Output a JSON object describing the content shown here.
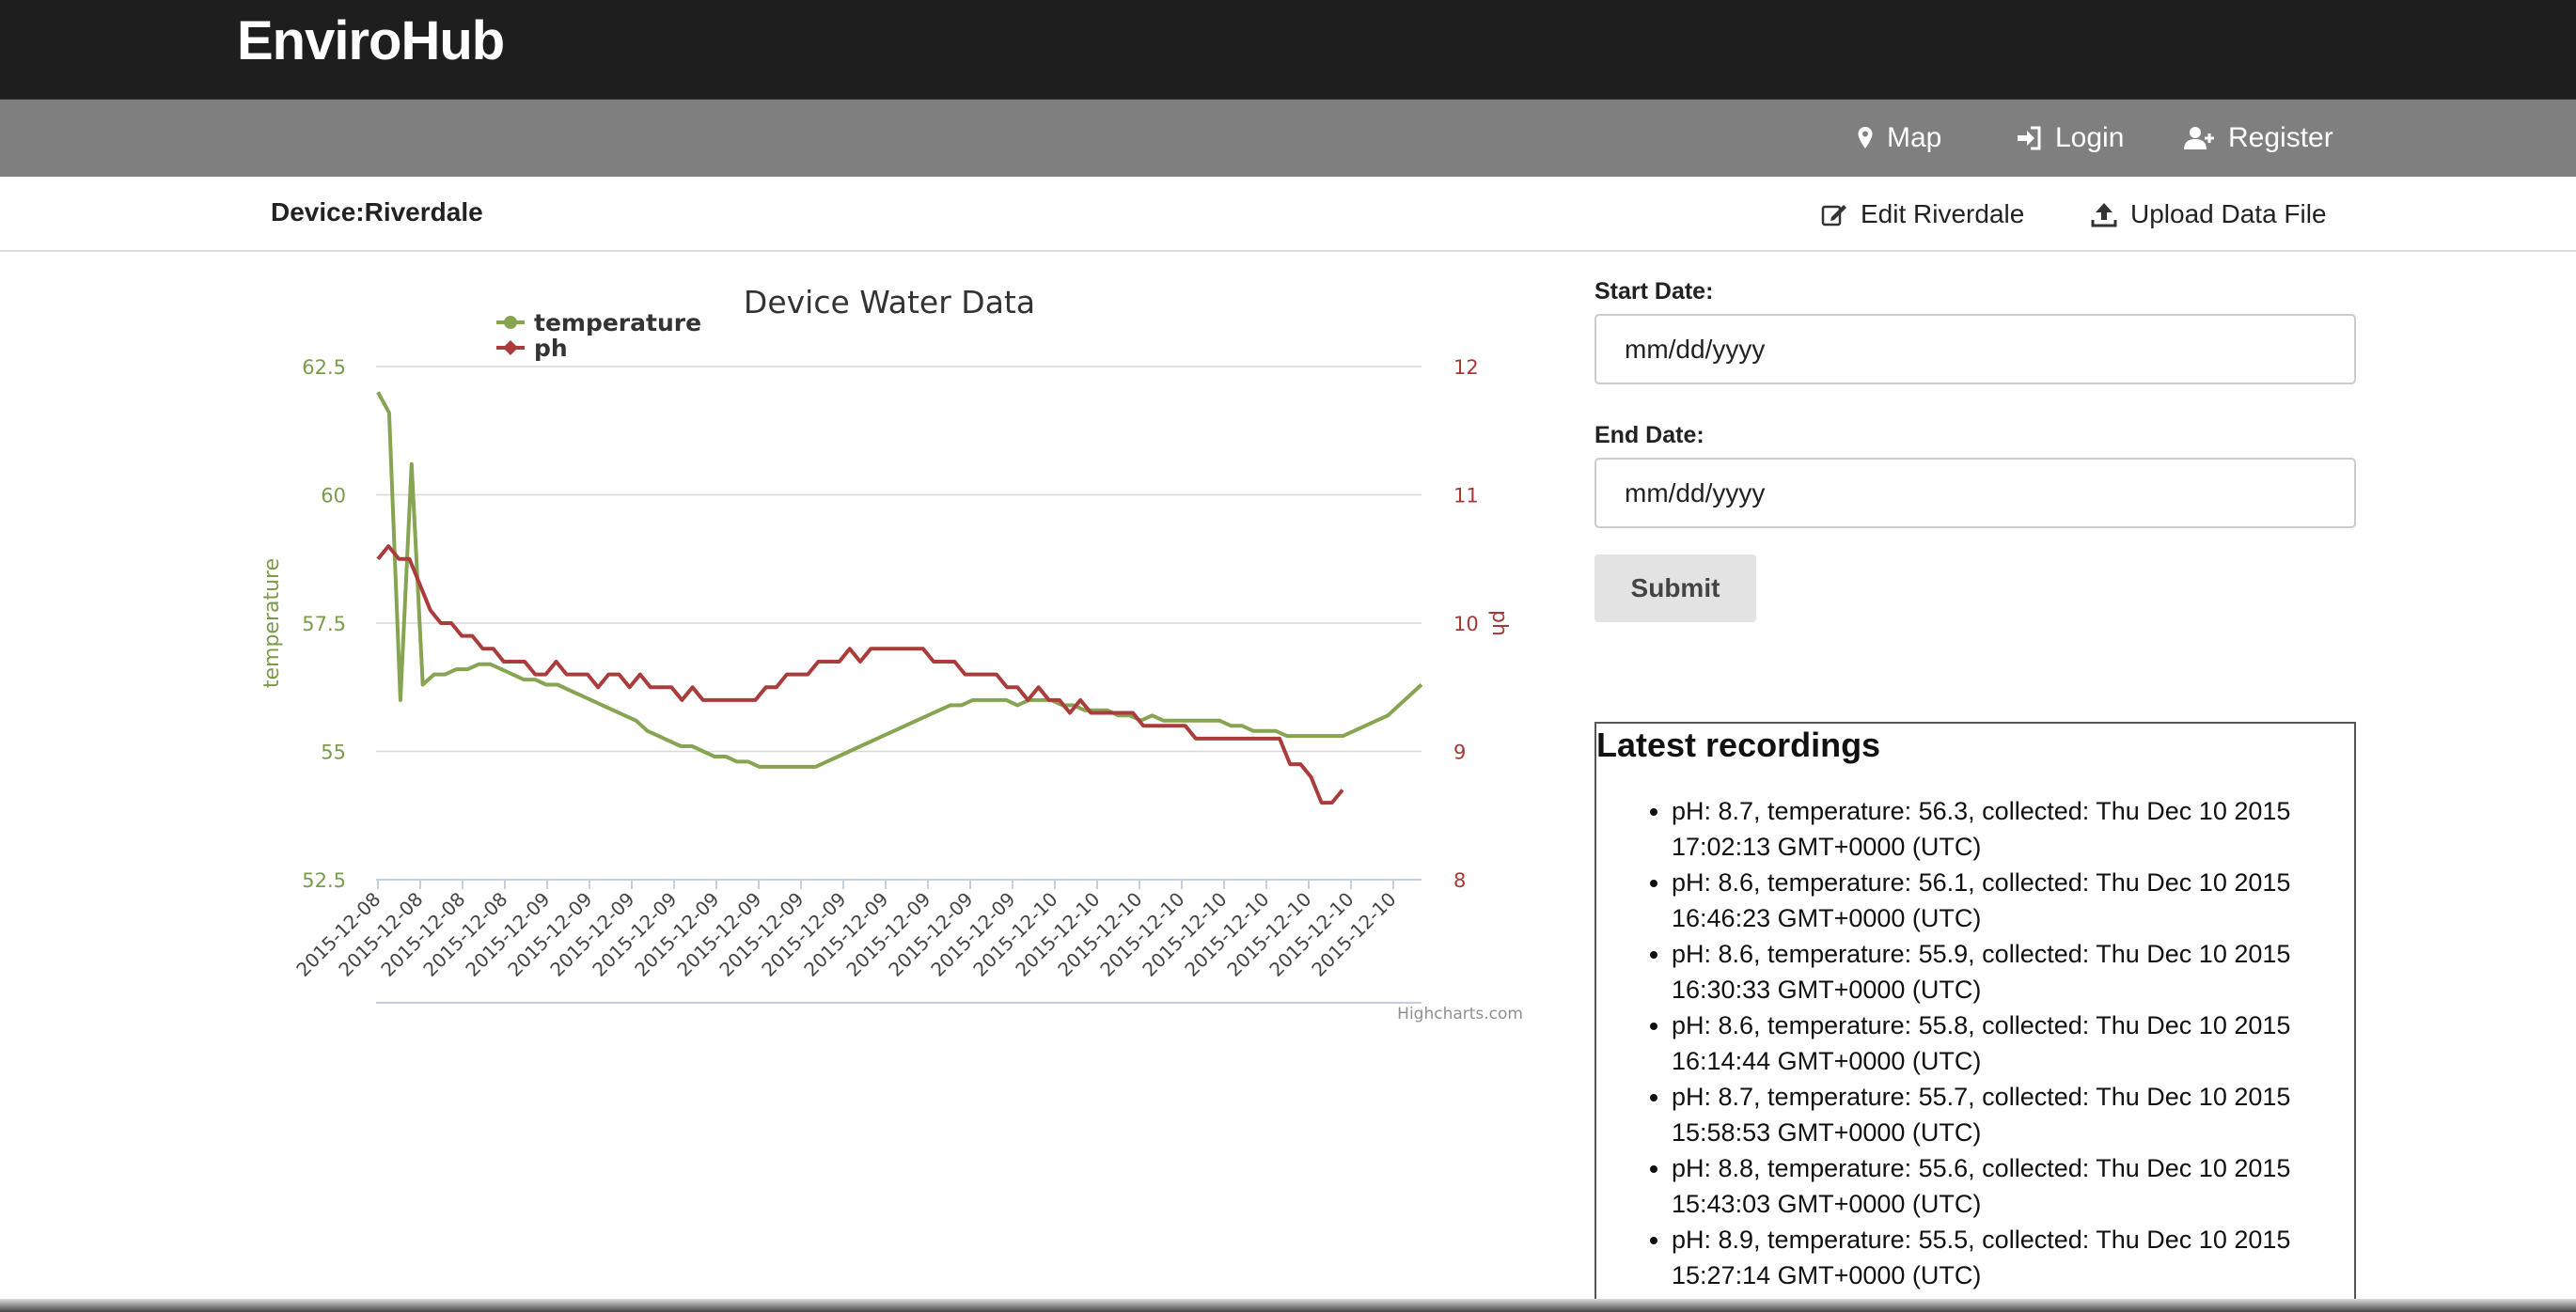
{
  "brand": "EnviroHub",
  "nav": {
    "map": "Map",
    "login": "Login",
    "register": "Register"
  },
  "device": {
    "title": "Device:Riverdale",
    "edit_label": "Edit Riverdale",
    "upload_label": "Upload Data File"
  },
  "form": {
    "start_label": "Start Date:",
    "start_placeholder": "mm/dd/yyyy",
    "end_label": "End Date:",
    "end_placeholder": "mm/dd/yyyy",
    "submit_label": "Submit"
  },
  "recordings": {
    "title": "Latest recordings",
    "items": [
      "pH: 8.7, temperature: 56.3, collected: Thu Dec 10 2015 17:02:13 GMT+0000 (UTC)",
      "pH: 8.6, temperature: 56.1, collected: Thu Dec 10 2015 16:46:23 GMT+0000 (UTC)",
      "pH: 8.6, temperature: 55.9, collected: Thu Dec 10 2015 16:30:33 GMT+0000 (UTC)",
      "pH: 8.6, temperature: 55.8, collected: Thu Dec 10 2015 16:14:44 GMT+0000 (UTC)",
      "pH: 8.7, temperature: 55.7, collected: Thu Dec 10 2015 15:58:53 GMT+0000 (UTC)",
      "pH: 8.8, temperature: 55.6, collected: Thu Dec 10 2015 15:43:03 GMT+0000 (UTC)",
      "pH: 8.9, temperature: 55.5, collected: Thu Dec 10 2015 15:27:14 GMT+0000 (UTC)"
    ]
  },
  "chart_data": {
    "type": "line",
    "title": "Device Water Data",
    "credits": "Highcharts.com",
    "legend_position": "top-left",
    "grid": true,
    "categories": [
      "2015-12-08",
      "2015-12-08",
      "2015-12-08",
      "2015-12-08",
      "2015-12-09",
      "2015-12-09",
      "2015-12-09",
      "2015-12-09",
      "2015-12-09",
      "2015-12-09",
      "2015-12-09",
      "2015-12-09",
      "2015-12-09",
      "2015-12-09",
      "2015-12-09",
      "2015-12-09",
      "2015-12-10",
      "2015-12-10",
      "2015-12-10",
      "2015-12-10",
      "2015-12-10",
      "2015-12-10",
      "2015-12-10",
      "2015-12-10",
      "2015-12-10"
    ],
    "y_left": {
      "label": "temperature",
      "min": 52.5,
      "max": 62.5,
      "ticks": [
        "52.5",
        "55",
        "57.5",
        "60",
        "62.5"
      ],
      "color": "#7b9c4a"
    },
    "y_right": {
      "label": "ph",
      "min": 8,
      "max": 12,
      "ticks": [
        "8",
        "9",
        "10",
        "11",
        "12"
      ],
      "color": "#a63838"
    },
    "series": [
      {
        "name": "temperature",
        "color": "#86a452",
        "axis": "left",
        "values": [
          62,
          61.6,
          56,
          60.6,
          56.3,
          56.5,
          56.5,
          56.6,
          56.6,
          56.7,
          56.7,
          56.6,
          56.5,
          56.4,
          56.4,
          56.3,
          56.3,
          56.2,
          56.1,
          56,
          55.9,
          55.8,
          55.7,
          55.6,
          55.4,
          55.3,
          55.2,
          55.1,
          55.1,
          55,
          54.9,
          54.9,
          54.8,
          54.8,
          54.7,
          54.7,
          54.7,
          54.7,
          54.7,
          54.7,
          54.8,
          54.9,
          55,
          55.1,
          55.2,
          55.3,
          55.4,
          55.5,
          55.6,
          55.7,
          55.8,
          55.9,
          55.9,
          56,
          56,
          56,
          56,
          55.9,
          56,
          56,
          56,
          55.9,
          55.9,
          55.8,
          55.8,
          55.8,
          55.7,
          55.7,
          55.6,
          55.7,
          55.6,
          55.6,
          55.6,
          55.6,
          55.6,
          55.6,
          55.5,
          55.5,
          55.4,
          55.4,
          55.4,
          55.3,
          55.3,
          55.3,
          55.3,
          55.3,
          55.3,
          55.4,
          55.5,
          55.6,
          55.7,
          55.9,
          56.1,
          56.3
        ]
      },
      {
        "name": "ph",
        "color": "#aa3c3c",
        "axis": "right",
        "values": [
          10.5,
          10.6,
          10.5,
          10.5,
          10.3,
          10.1,
          10,
          10,
          9.9,
          9.9,
          9.8,
          9.8,
          9.7,
          9.7,
          9.7,
          9.6,
          9.6,
          9.7,
          9.6,
          9.6,
          9.6,
          9.5,
          9.6,
          9.6,
          9.5,
          9.6,
          9.5,
          9.5,
          9.5,
          9.4,
          9.5,
          9.4,
          9.4,
          9.4,
          9.4,
          9.4,
          9.4,
          9.5,
          9.5,
          9.6,
          9.6,
          9.6,
          9.7,
          9.7,
          9.7,
          9.8,
          9.7,
          9.8,
          9.8,
          9.8,
          9.8,
          9.8,
          9.8,
          9.7,
          9.7,
          9.7,
          9.6,
          9.6,
          9.6,
          9.6,
          9.5,
          9.5,
          9.4,
          9.5,
          9.4,
          9.4,
          9.3,
          9.4,
          9.3,
          9.3,
          9.3,
          9.3,
          9.3,
          9.2,
          9.2,
          9.2,
          9.2,
          9.2,
          9.1,
          9.1,
          9.1,
          9.1,
          9.1,
          9.1,
          9.1,
          9.1,
          9.1,
          8.9,
          8.9,
          8.8,
          8.6,
          8.6,
          8.7
        ]
      }
    ]
  }
}
